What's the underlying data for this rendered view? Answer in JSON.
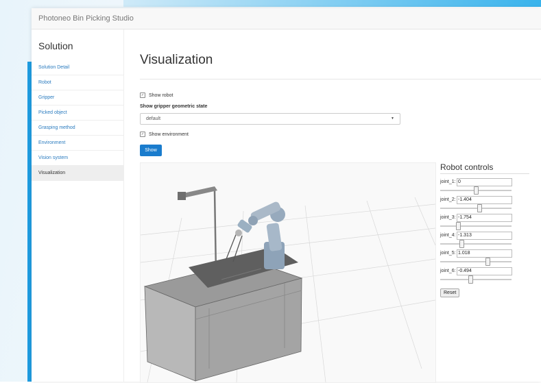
{
  "app": {
    "brand": "Photoneo Bin Picking Studio"
  },
  "sidebar": {
    "title": "Solution",
    "items": [
      {
        "label": "Solution Detail",
        "active": false
      },
      {
        "label": "Robot",
        "active": false
      },
      {
        "label": "Gripper",
        "active": false
      },
      {
        "label": "Picked object",
        "active": false
      },
      {
        "label": "Grasping method",
        "active": false
      },
      {
        "label": "Environment",
        "active": false
      },
      {
        "label": "Vision system",
        "active": false
      },
      {
        "label": "Visualization",
        "active": true
      }
    ]
  },
  "main": {
    "title": "Visualization",
    "show_robot": {
      "label": "Show robot",
      "checked": true
    },
    "gripper_state": {
      "label": "Show gripper geometric state",
      "value": "default"
    },
    "show_environment": {
      "label": "Show environment",
      "checked": true
    },
    "show_button": "Show"
  },
  "robot_controls": {
    "title": "Robot controls",
    "joints": [
      {
        "label": "joint_1:",
        "value": "0",
        "slider_fraction": 0.5
      },
      {
        "label": "joint_2:",
        "value": "-1.404",
        "slider_fraction": 0.55
      },
      {
        "label": "joint_3:",
        "value": "-1.754",
        "slider_fraction": 0.25
      },
      {
        "label": "joint_4:",
        "value": "-1.313",
        "slider_fraction": 0.3
      },
      {
        "label": "joint_5:",
        "value": "1.018",
        "slider_fraction": 0.66
      },
      {
        "label": "joint_6:",
        "value": "-0.494",
        "slider_fraction": 0.42
      }
    ],
    "reset_label": "Reset"
  }
}
